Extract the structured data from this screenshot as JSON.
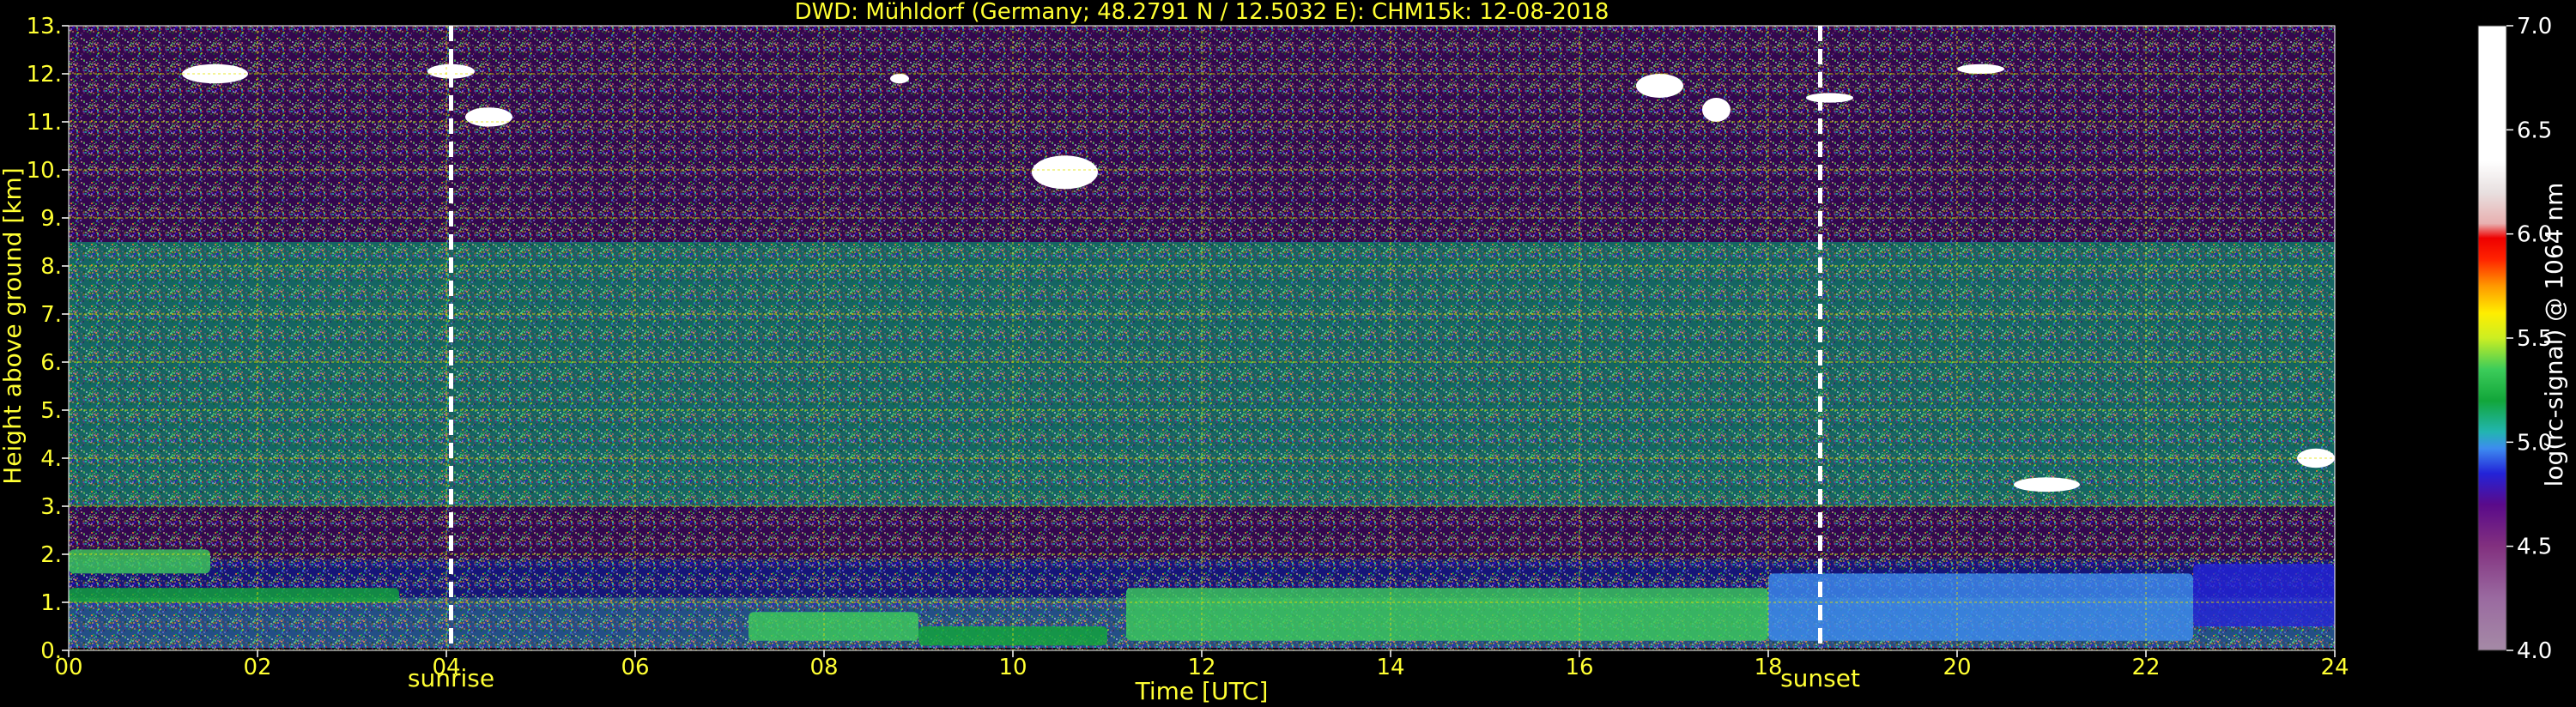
{
  "title": "DWD: Mühldorf (Germany; 48.2791 N / 12.5032 E):    CHM15k: 12-08-2018",
  "colors": {
    "text": "#ffff33",
    "grid": "#e5e500",
    "marker": "#ffffff",
    "background": "#000000"
  },
  "chart_data": {
    "type": "heatmap",
    "xlabel": "Time [UTC]",
    "ylabel": "Height above ground [km]",
    "xlim": [
      0,
      24
    ],
    "ylim": [
      0,
      13
    ],
    "xticks": [
      {
        "v": 0,
        "label": "00"
      },
      {
        "v": 2,
        "label": "02"
      },
      {
        "v": 4,
        "label": "04"
      },
      {
        "v": 6,
        "label": "06"
      },
      {
        "v": 8,
        "label": "08"
      },
      {
        "v": 10,
        "label": "10"
      },
      {
        "v": 12,
        "label": "12"
      },
      {
        "v": 14,
        "label": "14"
      },
      {
        "v": 16,
        "label": "16"
      },
      {
        "v": 18,
        "label": "18"
      },
      {
        "v": 20,
        "label": "20"
      },
      {
        "v": 22,
        "label": "22"
      },
      {
        "v": 24,
        "label": "24"
      }
    ],
    "yticks": [
      {
        "v": 0,
        "label": "0."
      },
      {
        "v": 1,
        "label": "1."
      },
      {
        "v": 2,
        "label": "2."
      },
      {
        "v": 3,
        "label": "3."
      },
      {
        "v": 4,
        "label": "4."
      },
      {
        "v": 5,
        "label": "5."
      },
      {
        "v": 6,
        "label": "6."
      },
      {
        "v": 7,
        "label": "7."
      },
      {
        "v": 8,
        "label": "8."
      },
      {
        "v": 9,
        "label": "9."
      },
      {
        "v": 10,
        "label": "10."
      },
      {
        "v": 11,
        "label": "11."
      },
      {
        "v": 12,
        "label": "12."
      },
      {
        "v": 13,
        "label": "13."
      }
    ],
    "grid": true,
    "markers": [
      {
        "name": "sunrise",
        "x": 4.05
      },
      {
        "name": "sunset",
        "x": 18.55
      }
    ],
    "colorbar": {
      "label": "log(rc-signal) @ 1064 nm",
      "range": [
        4.0,
        7.0
      ],
      "ticks": [
        {
          "v": 4.0,
          "label": "4.0"
        },
        {
          "v": 4.5,
          "label": "4.5"
        },
        {
          "v": 5.0,
          "label": "5.0"
        },
        {
          "v": 5.5,
          "label": "5.5"
        },
        {
          "v": 6.0,
          "label": "6.0"
        },
        {
          "v": 6.5,
          "label": "6.5"
        },
        {
          "v": 7.0,
          "label": "7.0"
        }
      ],
      "stops": [
        {
          "v": 4.0,
          "color": "#a58aa6"
        },
        {
          "v": 4.25,
          "color": "#9a6aa0"
        },
        {
          "v": 4.5,
          "color": "#82307f"
        },
        {
          "v": 4.7,
          "color": "#5a0a8a"
        },
        {
          "v": 4.85,
          "color": "#2323d8"
        },
        {
          "v": 4.97,
          "color": "#3d8cf0"
        },
        {
          "v": 5.05,
          "color": "#22b5b0"
        },
        {
          "v": 5.2,
          "color": "#12a63a"
        },
        {
          "v": 5.35,
          "color": "#3ccc5a"
        },
        {
          "v": 5.5,
          "color": "#ccee22"
        },
        {
          "v": 5.62,
          "color": "#ffee00"
        },
        {
          "v": 5.75,
          "color": "#ff9900"
        },
        {
          "v": 5.88,
          "color": "#ff2200"
        },
        {
          "v": 5.98,
          "color": "#ee0000"
        },
        {
          "v": 6.05,
          "color": "#e8b0b0"
        },
        {
          "v": 6.2,
          "color": "#e8e0e0"
        },
        {
          "v": 6.35,
          "color": "#ffffff"
        },
        {
          "v": 7.0,
          "color": "#ffffff"
        }
      ]
    },
    "layers": [
      {
        "name": "noise-upper",
        "x0": 0,
        "x1": 24,
        "y0": 8.5,
        "y1": 13,
        "value": 4.6
      },
      {
        "name": "noise-middle",
        "x0": 0,
        "x1": 24,
        "y0": 5,
        "y1": 8.5,
        "value": 5.0
      },
      {
        "name": "noise-lower",
        "x0": 0,
        "x1": 24,
        "y0": 3,
        "y1": 5,
        "value": 5.05
      },
      {
        "name": "residual-layer",
        "x0": 0,
        "x1": 24,
        "y0": 1.9,
        "y1": 3.0,
        "value": 4.65
      },
      {
        "name": "boundary-layer-top",
        "x0": 0,
        "x1": 24,
        "y0": 1.1,
        "y1": 1.9,
        "value": 4.72
      },
      {
        "name": "boundary-layer-base",
        "x0": 0,
        "x1": 24,
        "y0": 0.05,
        "y1": 1.1,
        "value": 4.9
      }
    ],
    "aerosol_features": [
      {
        "x0": 0,
        "x1": 1.5,
        "y0": 1.6,
        "y1": 2.1,
        "value": 5.25
      },
      {
        "x0": 0,
        "x1": 3.5,
        "y0": 1.0,
        "y1": 1.3,
        "value": 5.2
      },
      {
        "x0": 7.2,
        "x1": 9.0,
        "y0": 0.2,
        "y1": 0.8,
        "value": 5.22
      },
      {
        "x0": 9.0,
        "x1": 11.0,
        "y0": 0.1,
        "y1": 0.5,
        "value": 5.2
      },
      {
        "x0": 11.2,
        "x1": 18.0,
        "y0": 0.2,
        "y1": 1.3,
        "value": 5.22
      },
      {
        "x0": 18.0,
        "x1": 22.5,
        "y0": 0.2,
        "y1": 1.6,
        "value": 4.97
      },
      {
        "x0": 22.5,
        "x1": 24.0,
        "y0": 0.5,
        "y1": 1.8,
        "value": 4.85
      }
    ],
    "clouds": [
      {
        "x0": 1.2,
        "x1": 1.9,
        "y0": 11.8,
        "y1": 12.2,
        "value": 6.8
      },
      {
        "x0": 3.8,
        "x1": 4.3,
        "y0": 11.9,
        "y1": 12.2,
        "value": 6.8
      },
      {
        "x0": 4.2,
        "x1": 4.7,
        "y0": 10.9,
        "y1": 11.3,
        "value": 6.5
      },
      {
        "x0": 8.7,
        "x1": 8.9,
        "y0": 11.8,
        "y1": 12.0,
        "value": 6.5
      },
      {
        "x0": 10.2,
        "x1": 10.9,
        "y0": 9.6,
        "y1": 10.3,
        "value": 7.0
      },
      {
        "x0": 16.6,
        "x1": 17.1,
        "y0": 11.5,
        "y1": 12.0,
        "value": 7.0
      },
      {
        "x0": 17.3,
        "x1": 17.6,
        "y0": 11.0,
        "y1": 11.5,
        "value": 6.8
      },
      {
        "x0": 18.4,
        "x1": 18.9,
        "y0": 11.4,
        "y1": 11.6,
        "value": 6.8
      },
      {
        "x0": 20.0,
        "x1": 20.5,
        "y0": 12.0,
        "y1": 12.2,
        "value": 6.5
      },
      {
        "x0": 20.6,
        "x1": 21.3,
        "y0": 3.3,
        "y1": 3.6,
        "value": 6.5
      },
      {
        "x0": 23.6,
        "x1": 24.0,
        "y0": 3.8,
        "y1": 4.2,
        "value": 6.8
      }
    ]
  }
}
